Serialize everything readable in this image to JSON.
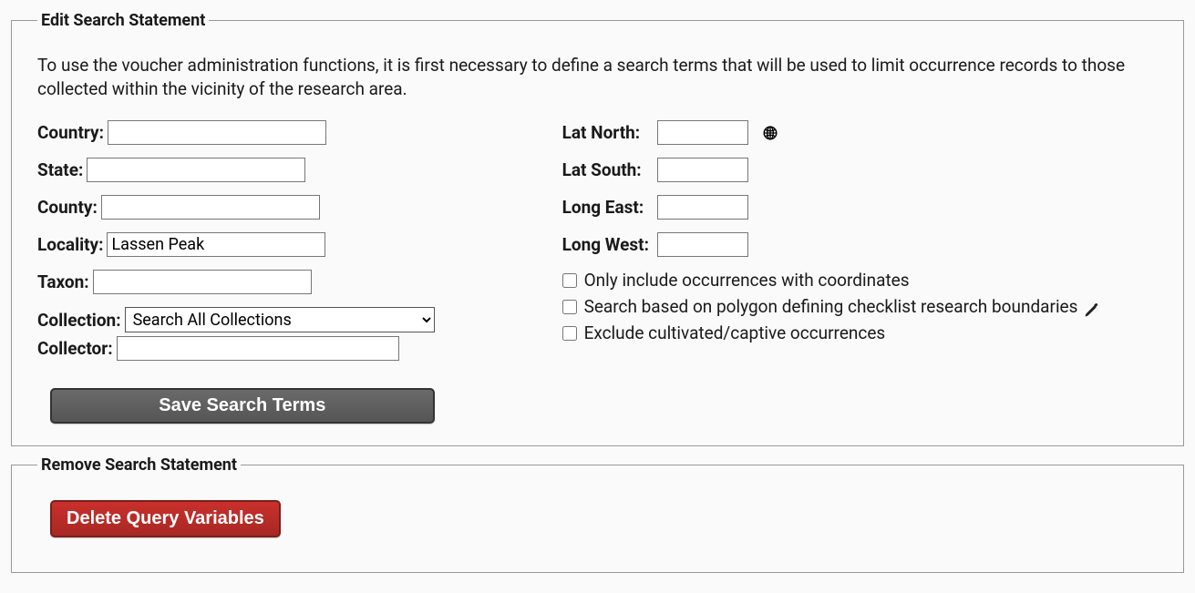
{
  "editSearch": {
    "legend": "Edit Search Statement",
    "intro": "To use the voucher administration functions, it is first necessary to define a search terms that will be used to limit occurrence records to those collected within the vicinity of the research area.",
    "labels": {
      "country": "Country:",
      "state": "State:",
      "county": "County:",
      "locality": "Locality:",
      "taxon": "Taxon:",
      "collection": "Collection:",
      "collector": "Collector:",
      "latNorth": "Lat North:",
      "latSouth": "Lat South:",
      "longEast": "Long East:",
      "longWest": "Long West:"
    },
    "values": {
      "country": "",
      "state": "",
      "county": "",
      "locality": "Lassen Peak",
      "taxon": "",
      "collection": "Search All Collections",
      "collector": "",
      "latNorth": "",
      "latSouth": "",
      "longEast": "",
      "longWest": ""
    },
    "collectionOptions": [
      "Search All Collections"
    ],
    "checkboxes": {
      "onlyCoords": "Only include occurrences with coordinates",
      "polygon": "Search based on polygon defining checklist research boundaries",
      "excludeCultivated": "Exclude cultivated/captive occurrences"
    },
    "saveButton": "Save Search Terms"
  },
  "removeSearch": {
    "legend": "Remove Search Statement",
    "deleteButton": "Delete Query Variables"
  }
}
